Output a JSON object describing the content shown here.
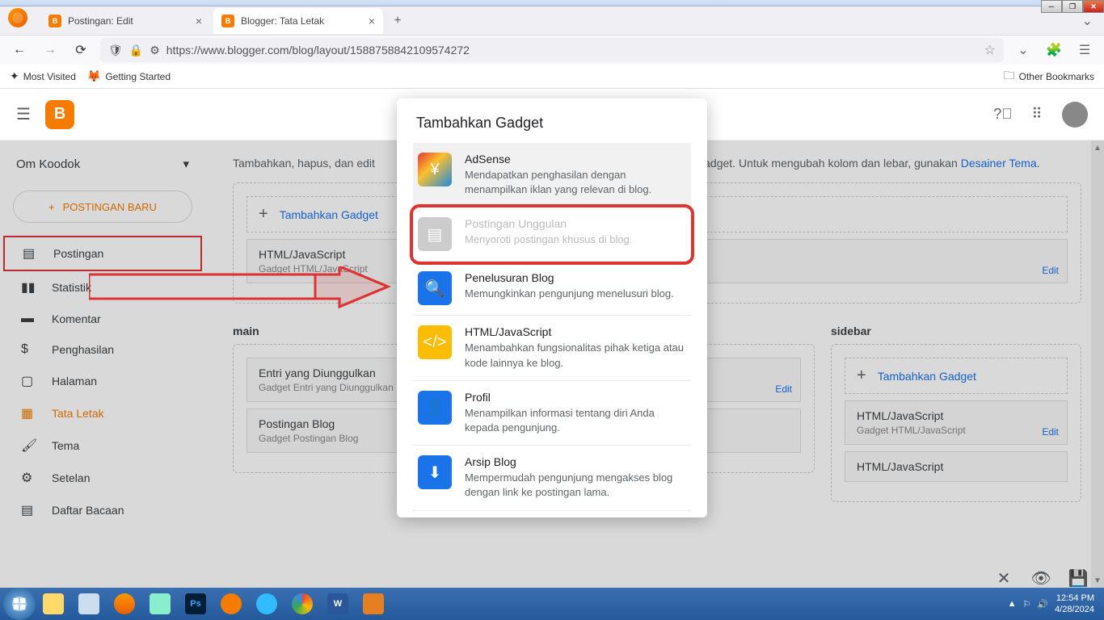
{
  "window": {
    "min": "─",
    "max": "❐",
    "close": "✕"
  },
  "tabs": [
    {
      "label": "Postingan: Edit"
    },
    {
      "label": "Blogger: Tata Letak"
    }
  ],
  "url": "https://www.blogger.com/blog/layout/1588758842109574272",
  "bookmarks": {
    "mv": "Most Visited",
    "gs": "Getting Started",
    "other": "Other Bookmarks"
  },
  "blogger": {
    "blogName": "Om Koodok",
    "newPost": "POSTINGAN BARU",
    "nav": [
      {
        "label": "Postingan"
      },
      {
        "label": "Statistik"
      },
      {
        "label": "Komentar"
      },
      {
        "label": "Penghasilan"
      },
      {
        "label": "Halaman"
      },
      {
        "label": "Tata Letak"
      },
      {
        "label": "Tema"
      },
      {
        "label": "Setelan"
      },
      {
        "label": "Daftar Bacaan"
      }
    ],
    "intro_a": "Tambahkan, hapus, dan edit",
    "intro_b": "g gadget. Untuk mengubah kolom dan lebar, gunakan ",
    "designer": "Desainer Tema",
    "addGadget": "Tambahkan Gadget",
    "sections": {
      "html": {
        "t": "HTML/JavaScript",
        "d": "Gadget HTML/JavaScript"
      },
      "main": "main",
      "entri": {
        "t": "Entri yang Diunggulkan",
        "d": "Gadget Entri yang Diunggulkan"
      },
      "post": {
        "t": "Postingan Blog",
        "d": "Gadget Postingan Blog"
      },
      "sidebar": "sidebar",
      "edit": "Edit"
    }
  },
  "modal": {
    "title": "Tambahkan Gadget",
    "items": [
      {
        "name": "AdSense",
        "desc": "Mendapatkan penghasilan dengan menampilkan iklan yang relevan di blog."
      },
      {
        "name": "Postingan Unggulan",
        "desc": "Menyoroti postingan khusus di blog."
      },
      {
        "name": "Penelusuran Blog",
        "desc": "Memungkinkan pengunjung menelusuri blog."
      },
      {
        "name": "HTML/JavaScript",
        "desc": "Menambahkan fungsionalitas pihak ketiga atau kode lainnya ke blog."
      },
      {
        "name": "Profil",
        "desc": "Menampilkan informasi tentang diri Anda kepada pengunjung."
      },
      {
        "name": "Arsip Blog",
        "desc": "Mempermudah pengunjung mengakses blog dengan link ke postingan lama."
      }
    ]
  },
  "tray": {
    "time": "12:54 PM",
    "date": "4/28/2024"
  }
}
